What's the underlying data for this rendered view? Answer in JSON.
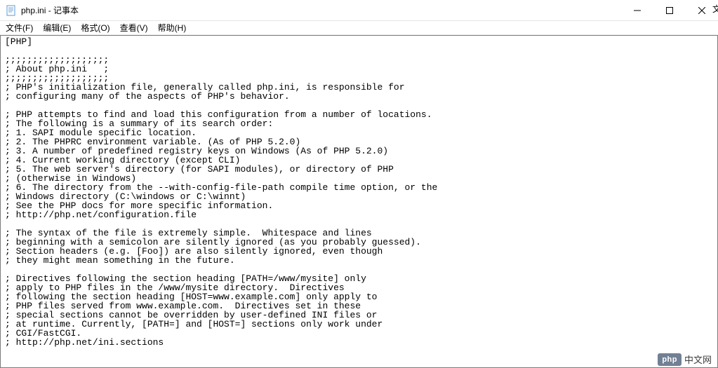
{
  "window": {
    "title": "php.ini - 记事本"
  },
  "menu": {
    "file": "文件(F)",
    "edit": "编辑(E)",
    "format": "格式(O)",
    "view": "查看(V)",
    "help": "帮助(H)"
  },
  "content": "[PHP]\n\n;;;;;;;;;;;;;;;;;;;\n; About php.ini   ;\n;;;;;;;;;;;;;;;;;;;\n; PHP's initialization file, generally called php.ini, is responsible for\n; configuring many of the aspects of PHP's behavior.\n\n; PHP attempts to find and load this configuration from a number of locations.\n; The following is a summary of its search order:\n; 1. SAPI module specific location.\n; 2. The PHPRC environment variable. (As of PHP 5.2.0)\n; 3. A number of predefined registry keys on Windows (As of PHP 5.2.0)\n; 4. Current working directory (except CLI)\n; 5. The web server's directory (for SAPI modules), or directory of PHP\n; (otherwise in Windows)\n; 6. The directory from the --with-config-file-path compile time option, or the\n; Windows directory (C:\\windows or C:\\winnt)\n; See the PHP docs for more specific information.\n; http://php.net/configuration.file\n\n; The syntax of the file is extremely simple.  Whitespace and lines\n; beginning with a semicolon are silently ignored (as you probably guessed).\n; Section headers (e.g. [Foo]) are also silently ignored, even though\n; they might mean something in the future.\n\n; Directives following the section heading [PATH=/www/mysite] only\n; apply to PHP files in the /www/mysite directory.  Directives\n; following the section heading [HOST=www.example.com] only apply to\n; PHP files served from www.example.com.  Directives set in these\n; special sections cannot be overridden by user-defined INI files or\n; at runtime. Currently, [PATH=] and [HOST=] sections only work under\n; CGI/FastCGI.\n; http://php.net/ini.sections",
  "watermark": {
    "badge": "php",
    "text": "中文网"
  },
  "cut_text": "文"
}
